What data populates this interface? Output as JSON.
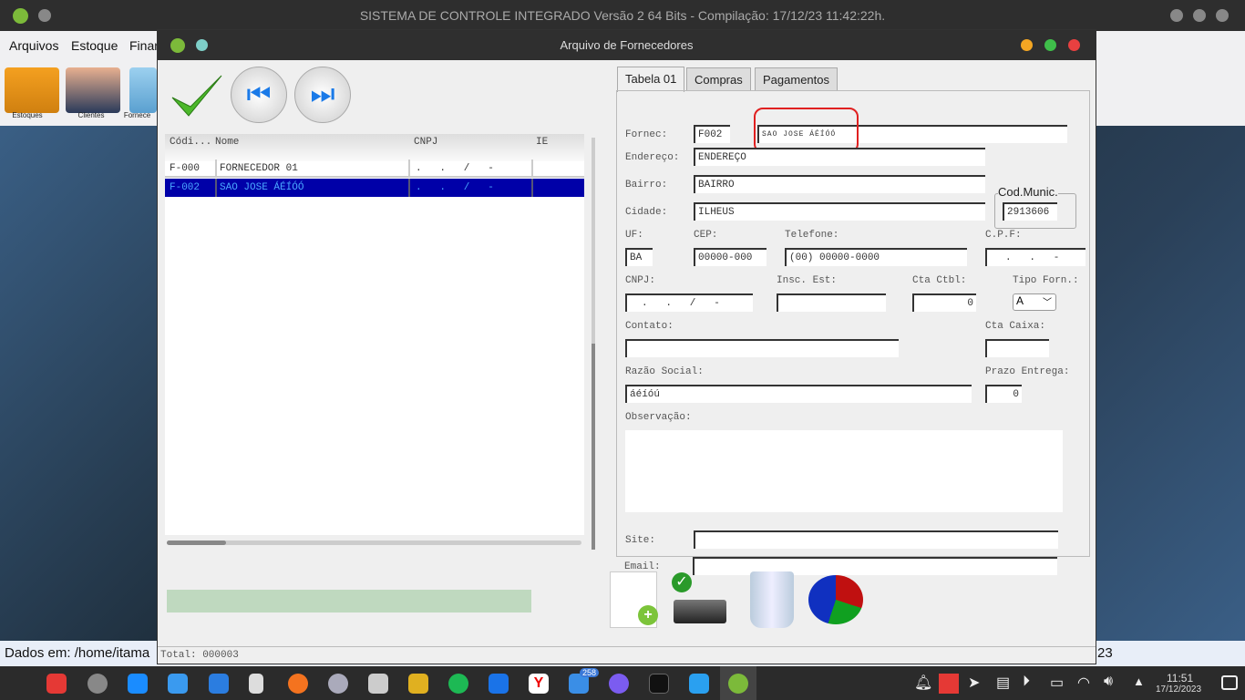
{
  "topbar": {
    "title": "SISTEMA DE CONTROLE INTEGRADO Versão 2 64 Bits - Compilação: 17/12/23 11:42:22h."
  },
  "menu": [
    "Arquivos",
    "Estoque",
    "Finan"
  ],
  "toolbar": [
    {
      "label": "Estoques",
      "icon": "forklift-icon"
    },
    {
      "label": "Clientes",
      "icon": "people-icon"
    },
    {
      "label": "Fornece",
      "icon": "folder-icon"
    }
  ],
  "status": {
    "text": "Dados em: /home/itama",
    "right": "23"
  },
  "window": {
    "title": "Arquivo de Fornecedores",
    "total": "Total: 000003"
  },
  "table": {
    "headers": [
      "Códi...",
      "Nome",
      "CNPJ",
      "IE"
    ],
    "rows": [
      {
        "code": "F-000",
        "name": "FORNECEDOR 01",
        "cnpj": ".   .   /   -",
        "ie": ""
      },
      {
        "code": "F-002",
        "name": "SAO JOSE ÁÉÍÓÓ",
        "cnpj": ".   .   /   -",
        "ie": ""
      }
    ]
  },
  "tabs": [
    "Tabela 01",
    "Compras",
    "Pagamentos"
  ],
  "form": {
    "fornec_label": "Fornec:",
    "fornec_code": "F002",
    "fornec_name": "SAO JOSE ÁÉÍÓÓ",
    "endereco_label": "Endereço:",
    "endereco": "ENDEREÇO",
    "bairro_label": "Bairro:",
    "bairro": "BAIRRO",
    "cidade_label": "Cidade:",
    "cidade": "ILHEUS",
    "codmunic_label": "Cod.Munic.",
    "codmunic": "2913606",
    "uf_label": "UF:",
    "uf": "BA",
    "cep_label": "CEP:",
    "cep": "00000-000",
    "telefone_label": "Telefone:",
    "telefone": "(00) 00000-0000",
    "cpf_label": "C.P.F:",
    "cpf": ".   .   -",
    "cnpj_label": "CNPJ:",
    "cnpj": ".   .   /   -",
    "insc_label": "Insc. Est:",
    "insc": "",
    "ctactbl_label": "Cta Ctbl:",
    "ctactbl": "0",
    "tipo_label": "Tipo Forn.:",
    "tipo": "A",
    "contato_label": "Contato:",
    "contato": "",
    "ctacaixa_label": "Cta Caixa:",
    "ctacaixa": "",
    "razao_label": "Razão Social:",
    "razao": "áéíóú",
    "prazo_label": "Prazo Entrega:",
    "prazo": "0",
    "obs_label": "Observação:",
    "obs": "",
    "site_label": "Site:",
    "site": "",
    "email_label": "Email:",
    "email": ""
  },
  "clock": {
    "time": "11:51",
    "date": "17/12/2023"
  },
  "taskbar_badge": "258"
}
